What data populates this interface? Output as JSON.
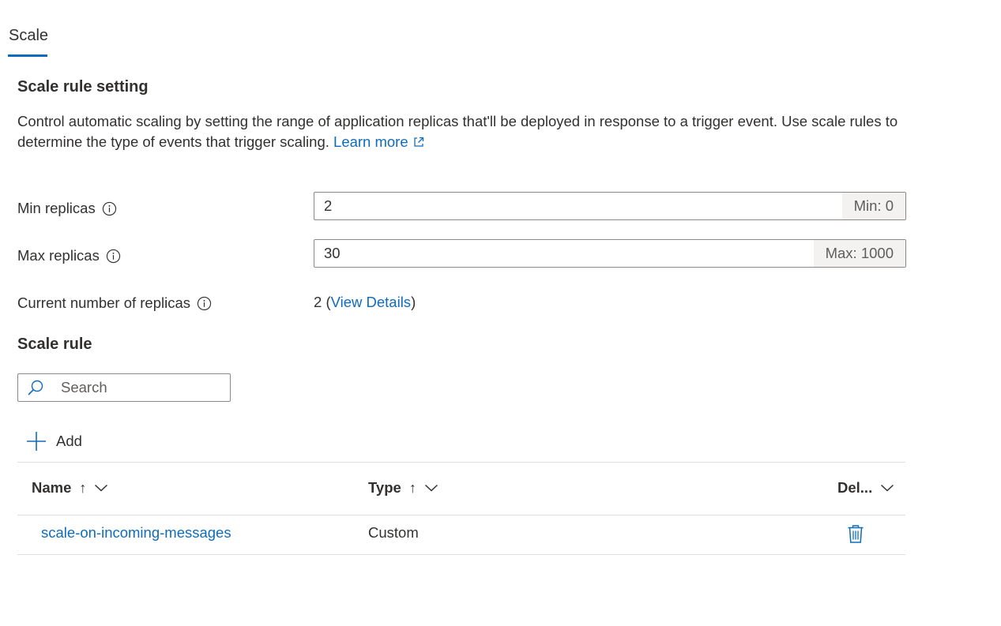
{
  "tab": {
    "label": "Scale"
  },
  "scale_setting": {
    "title": "Scale rule setting",
    "description": "Control automatic scaling by setting the range of application replicas that'll be deployed in response to a trigger event. Use scale rules to determine the type of events that trigger scaling.",
    "learn_more": "Learn more"
  },
  "min_replicas": {
    "label": "Min replicas",
    "value": "2",
    "suffix": "Min: 0"
  },
  "max_replicas": {
    "label": "Max replicas",
    "value": "30",
    "suffix": "Max: 1000"
  },
  "current_replicas": {
    "label": "Current number of replicas",
    "count": "2",
    "open_paren": "(",
    "link": "View Details",
    "close_paren": ")"
  },
  "scale_rule": {
    "title": "Scale rule",
    "search_placeholder": "Search",
    "add_label": "Add",
    "columns": [
      {
        "label": "Name",
        "sort": "↑"
      },
      {
        "label": "Type",
        "sort": "↑"
      },
      {
        "label": "Del..."
      }
    ],
    "rows": [
      {
        "name": "scale-on-incoming-messages",
        "type": "Custom"
      }
    ]
  },
  "colors": {
    "accent": "#0f6cbd",
    "text": "#323130",
    "border": "#8a8886",
    "suffix_bg": "#f3f2f1"
  },
  "icons": [
    "external-link-icon",
    "info-icon",
    "search-icon",
    "plus-icon",
    "chevron-down-icon",
    "trash-icon"
  ]
}
